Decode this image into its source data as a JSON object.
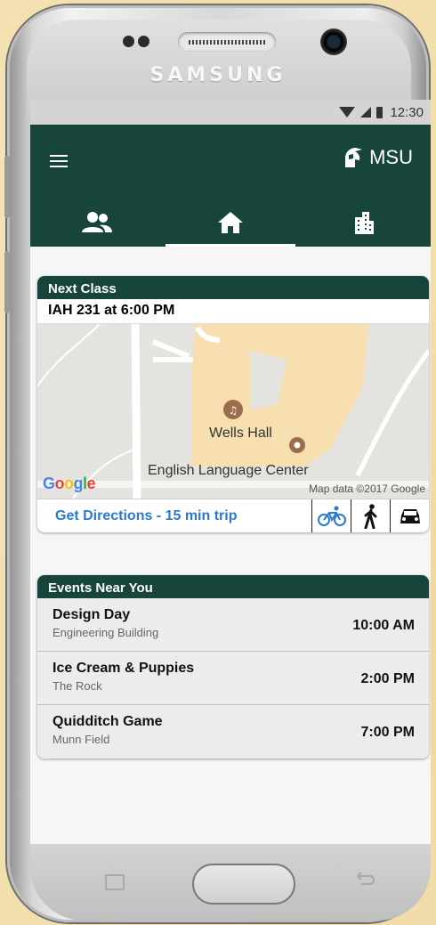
{
  "device": {
    "brand": "SAMSUNG"
  },
  "status_bar": {
    "time": "12:30"
  },
  "appbar": {
    "logo_text": "MSU",
    "tabs": [
      {
        "icon": "people-icon",
        "active": false
      },
      {
        "icon": "home-icon",
        "active": true
      },
      {
        "icon": "building-icon",
        "active": false
      }
    ]
  },
  "next_class": {
    "title": "Next Class",
    "class_info": "IAH 231 at 6:00 PM",
    "map": {
      "poi_1": "Wells Hall",
      "poi_2": "English Language Center",
      "attribution": "Map data ©2017 Google",
      "google_letters": [
        "G",
        "o",
        "o",
        "g",
        "l",
        "e"
      ]
    },
    "directions": "Get Directions - 15 min trip",
    "modes": [
      "bike-icon",
      "walk-icon",
      "car-icon"
    ]
  },
  "events": {
    "title": "Events Near You",
    "items": [
      {
        "name": "Design Day",
        "place": "Engineering Building",
        "time": "10:00 AM"
      },
      {
        "name": "Ice Cream & Puppies",
        "place": "The Rock",
        "time": "2:00 PM"
      },
      {
        "name": "Quidditch Game",
        "place": "Munn Field",
        "time": "7:00 PM"
      }
    ]
  },
  "colors": {
    "msu_green": "#18453b",
    "link_blue": "#2a7ad1",
    "map_building": "#f8dfb0"
  }
}
